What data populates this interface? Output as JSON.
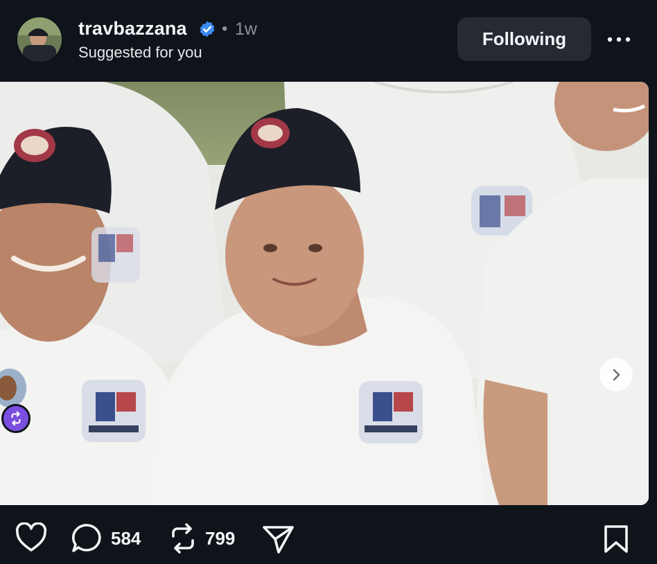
{
  "post": {
    "username": "travbazzana",
    "separator": "•",
    "time": "1w",
    "subtitle": "Suggested for you",
    "follow_label": "Following",
    "verified": true
  },
  "media": {
    "images_total": 3,
    "current_index": 1
  },
  "stats": {
    "replies": "584",
    "reposts": "799"
  },
  "colors": {
    "background": "#0f131a",
    "button_bg": "#262b33",
    "verified_blue": "#3d8bf2",
    "repost_badge": "#7b4fe0"
  },
  "icons": [
    "verified-icon",
    "more-icon",
    "chevron-right-icon",
    "repost-icon",
    "heart-icon",
    "comment-icon",
    "repost-icon",
    "share-icon",
    "bookmark-icon"
  ]
}
